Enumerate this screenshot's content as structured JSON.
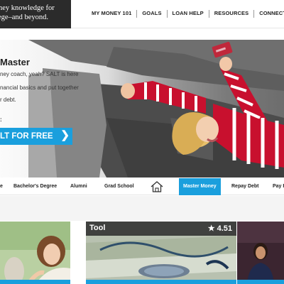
{
  "header": {
    "logo_line1": "ney knowledge for",
    "logo_line2": "lege–and beyond.",
    "nav": [
      {
        "label": "MY MONEY 101"
      },
      {
        "label": "GOALS"
      },
      {
        "label": "LOAN HELP"
      },
      {
        "label": "RESOURCES"
      },
      {
        "label": "CONNECT"
      }
    ]
  },
  "hero": {
    "title": "Master",
    "lines": [
      "ney coach, yeah? SALT is here",
      "nancial basics and put together",
      "r debt."
    ],
    "label": ":",
    "cta_label": "LT FOR FREE",
    "cta_icon": "chevron-right-icon",
    "cta_chevron": "❯"
  },
  "categories": [
    {
      "label": "e",
      "active": false
    },
    {
      "label": "Bachelor's Degree",
      "active": false
    },
    {
      "label": "Alumni",
      "active": false
    },
    {
      "label": "Grad School",
      "active": false
    },
    {
      "label": "home-icon",
      "icon": true
    },
    {
      "label": "Master Money",
      "active": true
    },
    {
      "label": "Repay  Debt",
      "active": false
    },
    {
      "label": "Pay F",
      "active": false
    }
  ],
  "cards": {
    "tool_label": "Tool",
    "tool_star": "★",
    "tool_rating": "4.51"
  },
  "colors": {
    "accent": "#1a9fdd",
    "logo_bg": "#2b2b2b",
    "stripe_red": "#c8102e"
  }
}
